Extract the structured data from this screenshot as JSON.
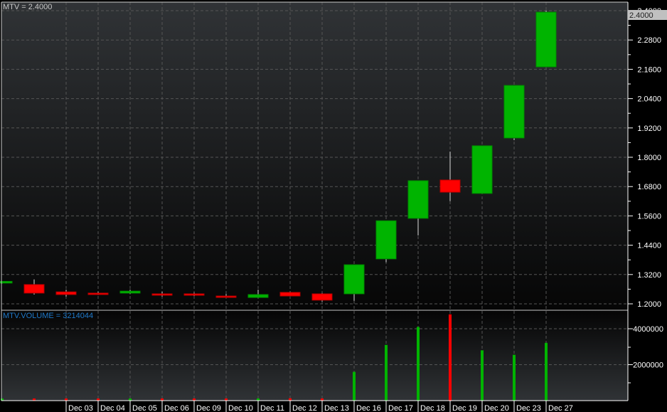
{
  "chart_data": {
    "type": "candlestick",
    "title": "MTV = 2.4000",
    "last_price_label": "2.4000",
    "categories": [
      "",
      "",
      "Dec 03",
      "Dec 04",
      "Dec 05",
      "Dec 06",
      "Dec 09",
      "Dec 10",
      "Dec 11",
      "Dec 12",
      "Dec 13",
      "Dec 16",
      "Dec 17",
      "Dec 18",
      "Dec 19",
      "Dec 20",
      "Dec 23",
      "Dec 27"
    ],
    "ohlc": [
      {
        "o": 1.285,
        "h": 1.292,
        "l": 1.283,
        "c": 1.292
      },
      {
        "o": 1.279,
        "h": 1.3,
        "l": 1.238,
        "c": 1.244
      },
      {
        "o": 1.249,
        "h": 1.258,
        "l": 1.23,
        "c": 1.238
      },
      {
        "o": 1.244,
        "h": 1.25,
        "l": 1.236,
        "c": 1.238
      },
      {
        "o": 1.244,
        "h": 1.258,
        "l": 1.24,
        "c": 1.252
      },
      {
        "o": 1.241,
        "h": 1.25,
        "l": 1.23,
        "c": 1.238
      },
      {
        "o": 1.241,
        "h": 1.246,
        "l": 1.232,
        "c": 1.235
      },
      {
        "o": 1.232,
        "h": 1.24,
        "l": 1.226,
        "c": 1.229
      },
      {
        "o": 1.226,
        "h": 1.258,
        "l": 1.224,
        "c": 1.238
      },
      {
        "o": 1.247,
        "h": 1.25,
        "l": 1.232,
        "c": 1.232
      },
      {
        "o": 1.241,
        "h": 1.244,
        "l": 1.209,
        "c": 1.215
      },
      {
        "o": 1.241,
        "h": 1.36,
        "l": 1.212,
        "c": 1.36
      },
      {
        "o": 1.384,
        "h": 1.54,
        "l": 1.37,
        "c": 1.54
      },
      {
        "o": 1.55,
        "h": 1.704,
        "l": 1.48,
        "c": 1.704
      },
      {
        "o": 1.707,
        "h": 1.823,
        "l": 1.62,
        "c": 1.657
      },
      {
        "o": 1.652,
        "h": 1.847,
        "l": 1.652,
        "c": 1.847
      },
      {
        "o": 1.879,
        "h": 2.094,
        "l": 1.87,
        "c": 2.094
      },
      {
        "o": 2.17,
        "h": 2.4,
        "l": 2.17,
        "c": 2.394
      }
    ],
    "price_axis": {
      "range": [
        1.2,
        2.4
      ],
      "ticks": [
        "1.2000",
        "1.3200",
        "1.4400",
        "1.5600",
        "1.6800",
        "1.8000",
        "1.9200",
        "2.0400",
        "2.1600",
        "2.2800",
        "2.4000"
      ]
    },
    "volume": {
      "title": "MTV.VOLUME = 3214044",
      "values": [
        40000,
        60000,
        70000,
        90000,
        80000,
        110000,
        100000,
        100000,
        120000,
        130000,
        80000,
        1600000,
        3100000,
        4100000,
        4800000,
        2800000,
        2550000,
        3214044
      ],
      "range": [
        0,
        4800000
      ],
      "ticks": [
        "2000000",
        "4000000"
      ]
    },
    "colors": {
      "up": "#00b400",
      "down": "#ff0000",
      "grid": "#5a5a5a",
      "axis": "#ffffff",
      "volume_label": "#1e78c8"
    },
    "grid": true
  }
}
